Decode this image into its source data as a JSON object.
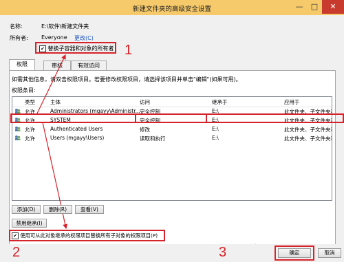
{
  "window": {
    "title": "新建文件夹的高级安全设置",
    "min_icon": "—",
    "max_icon": "□",
    "close_icon": "✕"
  },
  "name_label": "名称:",
  "name_value": "E:\\软件\\新建文件夹",
  "owner_label": "所有者:",
  "owner_value": "Everyone",
  "owner_change_link": "更改(C)",
  "replace_owner_checkbox": {
    "label": "替换子容器和对象的所有者",
    "checked": true
  },
  "tabs": [
    {
      "label": "权限"
    },
    {
      "label": "审核"
    },
    {
      "label": "有效访问"
    }
  ],
  "instructions": "如需其他信息，请双击权限项目。若要修改权限项目，请选择该项目并单击\"编辑\"(如果可用)。",
  "entries_label": "权限条目:",
  "columns": {
    "type": "类型",
    "principal": "主体",
    "access": "访问",
    "inherited_from": "继承于",
    "applies_to": "应用于"
  },
  "rows": [
    {
      "type": "允许",
      "principal": "Administrators (mgayy\\Administr...",
      "access": "完全控制",
      "inherited_from": "E:\\",
      "applies_to": "此文件夹、子文件夹和文件"
    },
    {
      "type": "允许",
      "principal": "SYSTEM",
      "access": "完全控制",
      "inherited_from": "E:\\",
      "applies_to": "此文件夹、子文件夹和文件"
    },
    {
      "type": "允许",
      "principal": "Authenticated Users",
      "access": "修改",
      "inherited_from": "E:\\",
      "applies_to": "此文件夹、子文件夹和文件"
    },
    {
      "type": "允许",
      "principal": "Users (mgayy\\Users)",
      "access": "读取和执行",
      "inherited_from": "E:\\",
      "applies_to": "此文件夹、子文件夹和文件"
    }
  ],
  "buttons": {
    "add": "添加(D)",
    "remove": "删除(R)",
    "view": "查看(V)",
    "disable_inheritance": "禁用继承(I)",
    "ok": "确定",
    "cancel": "取消"
  },
  "replace_child_perms_checkbox": {
    "label": "使用可从此对象继承的权限项目替换所有子对象的权限项目(P)",
    "checked": true
  },
  "annotations": {
    "n1": "1",
    "n2": "2",
    "n3": "3"
  },
  "colors": {
    "title_bar": "#f6c96a",
    "highlight_red": "#d6222a",
    "link_blue": "#1f58c4"
  }
}
